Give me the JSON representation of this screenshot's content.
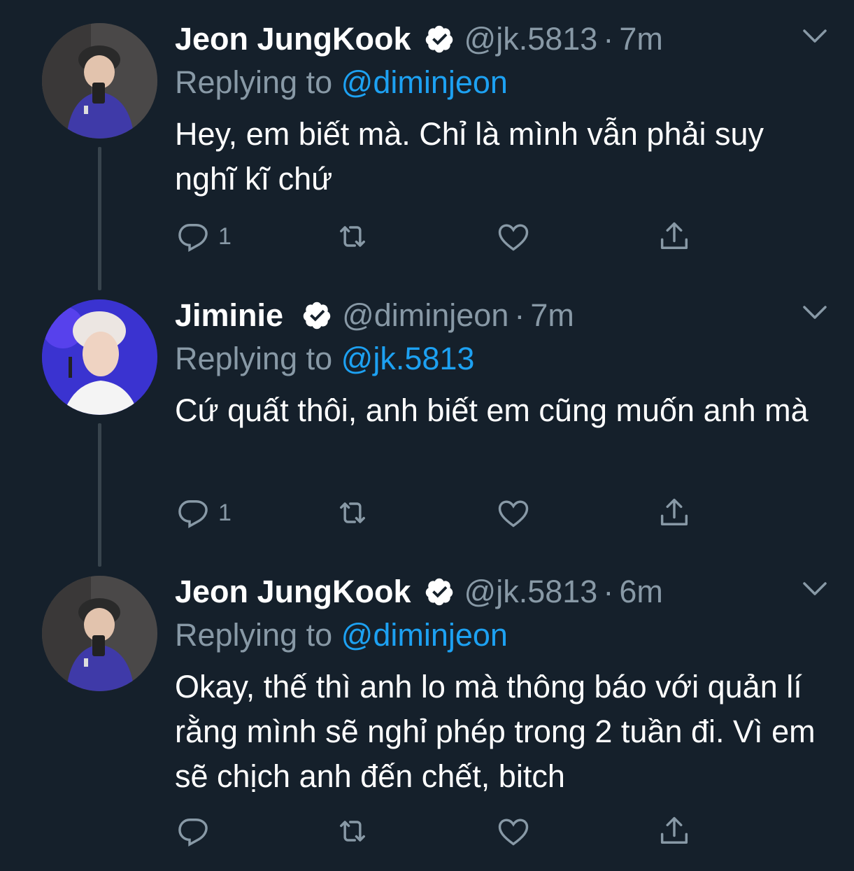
{
  "colors": {
    "background": "#15202b",
    "text": "#ffffff",
    "muted": "#8899a6",
    "link": "#1da1f2",
    "thread_line": "#38444d"
  },
  "tweets": [
    {
      "name": "Jeon JungKook",
      "handle": "@jk.5813",
      "separator": "·",
      "time": "7m",
      "replying_label": "Replying to",
      "replying_to": "@diminjeon",
      "text": "Hey, em biết mà. Chỉ là mình vẫn phải suy nghĩ kĩ chứ",
      "reply_count": "1"
    },
    {
      "name": "Jiminie",
      "handle": "@diminjeon",
      "separator": "·",
      "time": "7m",
      "replying_label": "Replying to",
      "replying_to": "@jk.5813",
      "text": "Cứ quất thôi, anh biết em cũng muốn anh mà",
      "reply_count": "1"
    },
    {
      "name": "Jeon JungKook",
      "handle": "@jk.5813",
      "separator": "·",
      "time": "6m",
      "replying_label": "Replying to",
      "replying_to": "@diminjeon",
      "text": "Okay, thế thì anh lo mà thông báo với quản lí rằng mình sẽ nghỉ phép trong 2 tuần đi. Vì em sẽ chịch anh đến chết, bitch",
      "reply_count": ""
    }
  ],
  "icons": [
    "verified-badge-icon",
    "chevron-down-icon",
    "reply-icon",
    "retweet-icon",
    "like-icon",
    "share-icon"
  ]
}
